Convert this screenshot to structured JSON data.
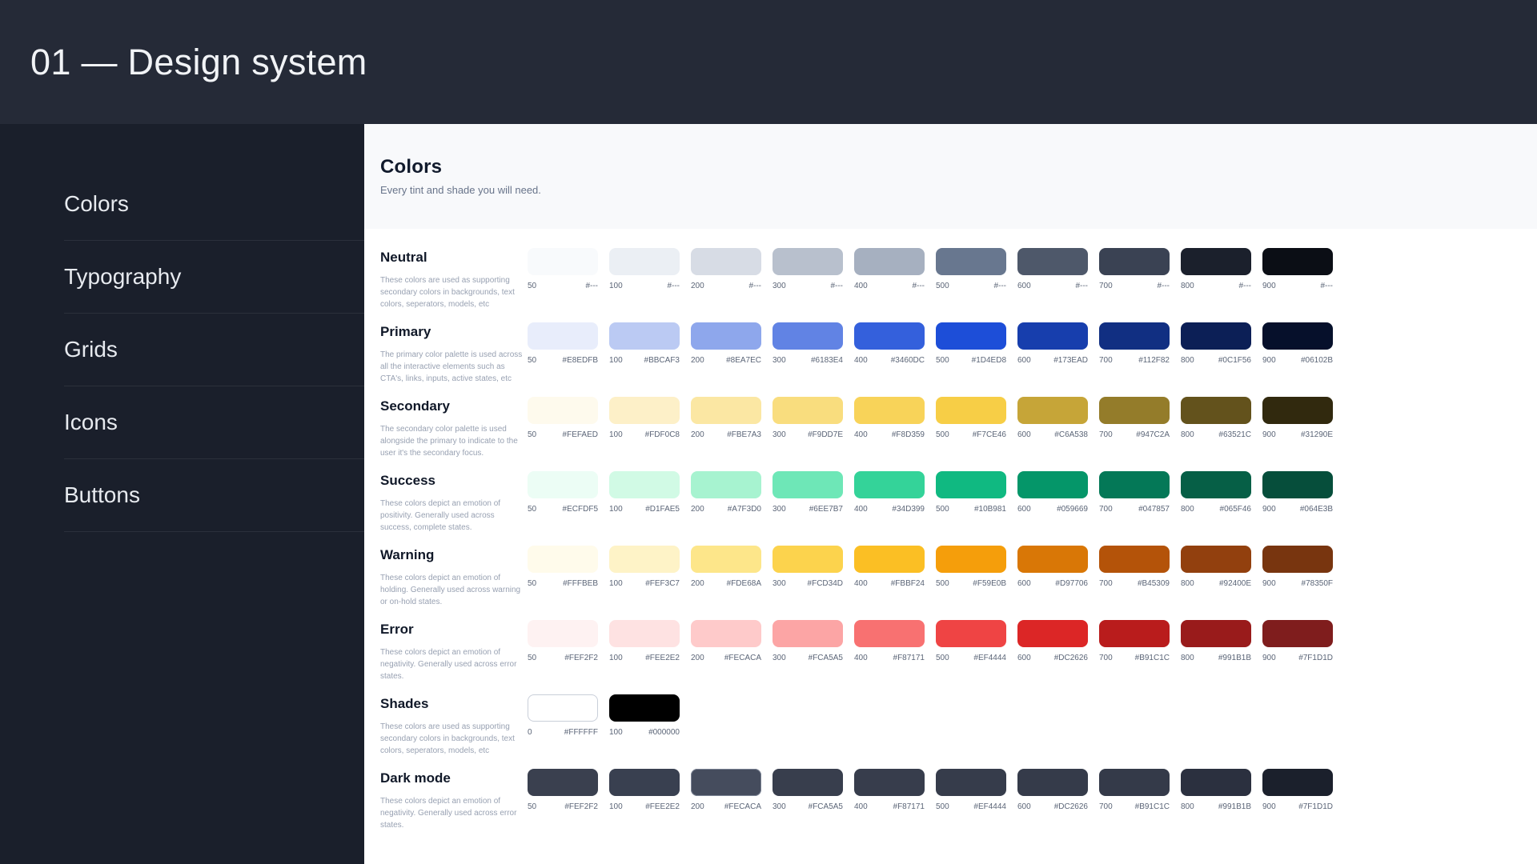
{
  "header": {
    "title": "01 — Design system"
  },
  "sidebar": {
    "items": [
      {
        "label": "Colors"
      },
      {
        "label": "Typography"
      },
      {
        "label": "Grids"
      },
      {
        "label": "Icons"
      },
      {
        "label": "Buttons"
      }
    ]
  },
  "page": {
    "title": "Colors",
    "subtitle": "Every tint and shade you will need."
  },
  "palette": {
    "sections": [
      {
        "title": "Neutral",
        "description": "These colors are used as supporting secondary colors in backgrounds, text colors, seperators, models, etc",
        "swatches": [
          {
            "shade": "50",
            "hex": "#---",
            "fill": "#F8FAFC"
          },
          {
            "shade": "100",
            "hex": "#---",
            "fill": "#EBEFF4"
          },
          {
            "shade": "200",
            "hex": "#---",
            "fill": "#D7DCE5"
          },
          {
            "shade": "300",
            "hex": "#---",
            "fill": "#B8C0CD"
          },
          {
            "shade": "400",
            "hex": "#---",
            "fill": "#A6B0C0"
          },
          {
            "shade": "500",
            "hex": "#---",
            "fill": "#68778F"
          },
          {
            "shade": "600",
            "hex": "#---",
            "fill": "#4E586A"
          },
          {
            "shade": "700",
            "hex": "#---",
            "fill": "#3A4253"
          },
          {
            "shade": "800",
            "hex": "#---",
            "fill": "#1B202C"
          },
          {
            "shade": "900",
            "hex": "#---",
            "fill": "#0B0E15"
          }
        ]
      },
      {
        "title": "Primary",
        "description": "The primary color palette is used across all the interactive elements such as CTA's, links, inputs, active states, etc",
        "swatches": [
          {
            "shade": "50",
            "hex": "#E8EDFB",
            "fill": "#E8EDFB"
          },
          {
            "shade": "100",
            "hex": "#BBCAF3",
            "fill": "#BBCAF3"
          },
          {
            "shade": "200",
            "hex": "#8EA7EC",
            "fill": "#8EA7EC"
          },
          {
            "shade": "300",
            "hex": "#6183E4",
            "fill": "#6183E4"
          },
          {
            "shade": "400",
            "hex": "#3460DC",
            "fill": "#3460DC"
          },
          {
            "shade": "500",
            "hex": "#1D4ED8",
            "fill": "#1D4ED8"
          },
          {
            "shade": "600",
            "hex": "#173EAD",
            "fill": "#173EAD"
          },
          {
            "shade": "700",
            "hex": "#112F82",
            "fill": "#112F82"
          },
          {
            "shade": "800",
            "hex": "#0C1F56",
            "fill": "#0C1F56"
          },
          {
            "shade": "900",
            "hex": "#06102B",
            "fill": "#06102B"
          }
        ]
      },
      {
        "title": "Secondary",
        "description": "The secondary color palette is used alongside the primary to indicate to the user it's the secondary focus.",
        "swatches": [
          {
            "shade": "50",
            "hex": "#FEFAED",
            "fill": "#FEFAED"
          },
          {
            "shade": "100",
            "hex": "#FDF0C8",
            "fill": "#FDF0C8"
          },
          {
            "shade": "200",
            "hex": "#FBE7A3",
            "fill": "#FBE7A3"
          },
          {
            "shade": "300",
            "hex": "#F9DD7E",
            "fill": "#F9DD7E"
          },
          {
            "shade": "400",
            "hex": "#F8D359",
            "fill": "#F8D359"
          },
          {
            "shade": "500",
            "hex": "#F7CE46",
            "fill": "#F7CE46"
          },
          {
            "shade": "600",
            "hex": "#C6A538",
            "fill": "#C6A538"
          },
          {
            "shade": "700",
            "hex": "#947C2A",
            "fill": "#947C2A"
          },
          {
            "shade": "800",
            "hex": "#63521C",
            "fill": "#63521C"
          },
          {
            "shade": "900",
            "hex": "#31290E",
            "fill": "#31290E"
          }
        ]
      },
      {
        "title": "Success",
        "description": "These colors depict an emotion of positivity. Generally used across success, complete states.",
        "swatches": [
          {
            "shade": "50",
            "hex": "#ECFDF5",
            "fill": "#ECFDF5"
          },
          {
            "shade": "100",
            "hex": "#D1FAE5",
            "fill": "#D1FAE5"
          },
          {
            "shade": "200",
            "hex": "#A7F3D0",
            "fill": "#A7F3D0"
          },
          {
            "shade": "300",
            "hex": "#6EE7B7",
            "fill": "#6EE7B7"
          },
          {
            "shade": "400",
            "hex": "#34D399",
            "fill": "#34D399"
          },
          {
            "shade": "500",
            "hex": "#10B981",
            "fill": "#10B981"
          },
          {
            "shade": "600",
            "hex": "#059669",
            "fill": "#059669"
          },
          {
            "shade": "700",
            "hex": "#047857",
            "fill": "#047857"
          },
          {
            "shade": "800",
            "hex": "#065F46",
            "fill": "#065F46"
          },
          {
            "shade": "900",
            "hex": "#064E3B",
            "fill": "#064E3B"
          }
        ]
      },
      {
        "title": "Warning",
        "description": "These colors depict an emotion of holding. Generally used across warning or on-hold states.",
        "swatches": [
          {
            "shade": "50",
            "hex": "#FFFBEB",
            "fill": "#FFFBEB"
          },
          {
            "shade": "100",
            "hex": "#FEF3C7",
            "fill": "#FEF3C7"
          },
          {
            "shade": "200",
            "hex": "#FDE68A",
            "fill": "#FDE68A"
          },
          {
            "shade": "300",
            "hex": "#FCD34D",
            "fill": "#FCD34D"
          },
          {
            "shade": "400",
            "hex": "#FBBF24",
            "fill": "#FBBF24"
          },
          {
            "shade": "500",
            "hex": "#F59E0B",
            "fill": "#F59E0B"
          },
          {
            "shade": "600",
            "hex": "#D97706",
            "fill": "#D97706"
          },
          {
            "shade": "700",
            "hex": "#B45309",
            "fill": "#B45309"
          },
          {
            "shade": "800",
            "hex": "#92400E",
            "fill": "#92400E"
          },
          {
            "shade": "900",
            "hex": "#78350F",
            "fill": "#78350F"
          }
        ]
      },
      {
        "title": "Error",
        "description": "These colors depict an emotion of negativity. Generally used across error states.",
        "swatches": [
          {
            "shade": "50",
            "hex": "#FEF2F2",
            "fill": "#FEF2F2"
          },
          {
            "shade": "100",
            "hex": "#FEE2E2",
            "fill": "#FEE2E2"
          },
          {
            "shade": "200",
            "hex": "#FECACA",
            "fill": "#FECACA"
          },
          {
            "shade": "300",
            "hex": "#FCA5A5",
            "fill": "#FCA5A5"
          },
          {
            "shade": "400",
            "hex": "#F87171",
            "fill": "#F87171"
          },
          {
            "shade": "500",
            "hex": "#EF4444",
            "fill": "#EF4444"
          },
          {
            "shade": "600",
            "hex": "#DC2626",
            "fill": "#DC2626"
          },
          {
            "shade": "700",
            "hex": "#B91C1C",
            "fill": "#B91C1C"
          },
          {
            "shade": "800",
            "hex": "#991B1B",
            "fill": "#991B1B"
          },
          {
            "shade": "900",
            "hex": "#7F1D1D",
            "fill": "#7F1D1D"
          }
        ]
      },
      {
        "title": "Shades",
        "description": "These colors are used as supporting secondary colors in backgrounds, text colors, seperators, models, etc",
        "swatches": [
          {
            "shade": "0",
            "hex": "#FFFFFF",
            "fill": "#FFFFFF",
            "border": "#C9CFD9"
          },
          {
            "shade": "100",
            "hex": "#000000",
            "fill": "#000000"
          }
        ]
      },
      {
        "title": "Dark mode",
        "description": "These colors depict an emotion of negativity. Generally used across error states.",
        "swatches": [
          {
            "shade": "50",
            "hex": "#FEF2F2",
            "fill": "#3A404F"
          },
          {
            "shade": "100",
            "hex": "#FEE2E2",
            "fill": "#394050"
          },
          {
            "shade": "200",
            "hex": "#FECACA",
            "fill": "#454C5D",
            "border": "#7B8394"
          },
          {
            "shade": "300",
            "hex": "#FCA5A5",
            "fill": "#383E4D"
          },
          {
            "shade": "400",
            "hex": "#F87171",
            "fill": "#373D4C"
          },
          {
            "shade": "500",
            "hex": "#EF4444",
            "fill": "#363C4B"
          },
          {
            "shade": "600",
            "hex": "#DC2626",
            "fill": "#353B4A"
          },
          {
            "shade": "700",
            "hex": "#B91C1C",
            "fill": "#343A49"
          },
          {
            "shade": "800",
            "hex": "#991B1B",
            "fill": "#2B303F"
          },
          {
            "shade": "900",
            "hex": "#7F1D1D",
            "fill": "#1B202C"
          }
        ]
      }
    ]
  }
}
